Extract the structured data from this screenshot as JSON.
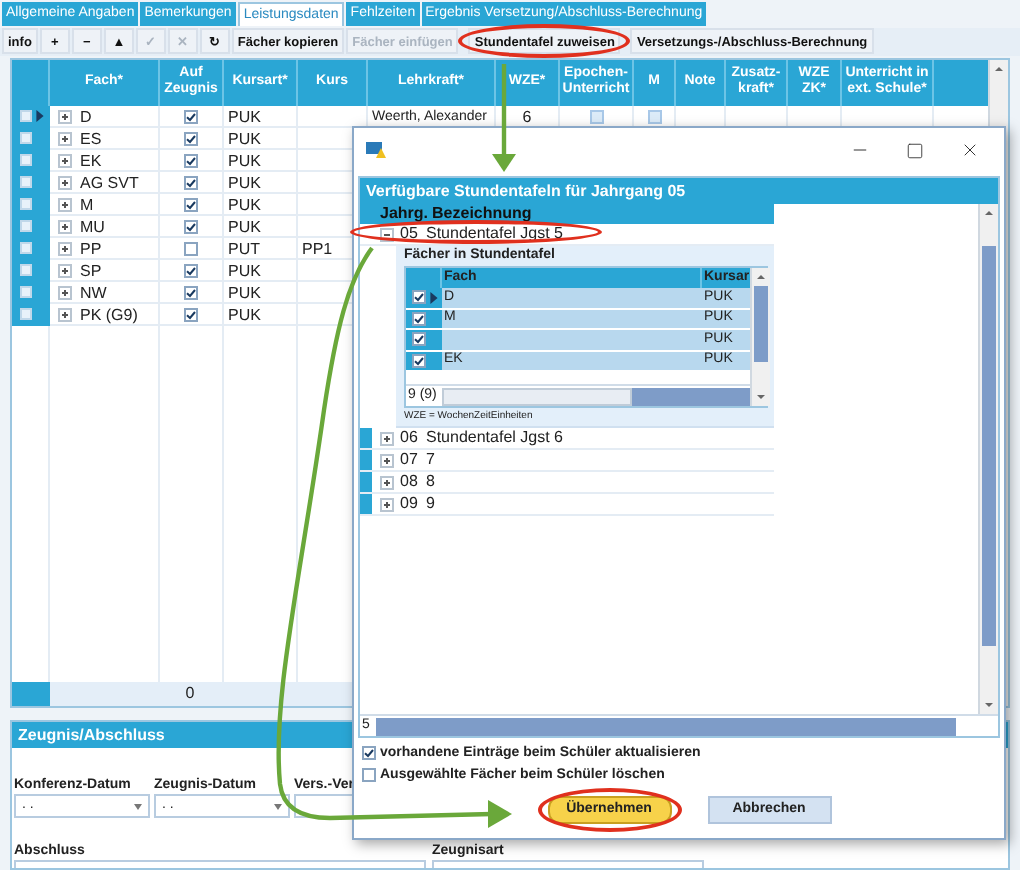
{
  "tabs": [
    {
      "label": "Allgemeine Angaben",
      "selected": false
    },
    {
      "label": "Bemerkungen",
      "selected": false
    },
    {
      "label": "Leistungsdaten",
      "selected": true
    },
    {
      "label": "Fehlzeiten",
      "selected": false
    },
    {
      "label": "Ergebnis Versetzung/Abschluss-Berechnung",
      "selected": false
    }
  ],
  "toolbar": [
    {
      "label": "info",
      "kind": "text",
      "disabled": false,
      "highlighted": false
    },
    {
      "label": "+",
      "kind": "symbol",
      "disabled": false,
      "highlighted": false
    },
    {
      "label": "−",
      "kind": "symbol",
      "disabled": false,
      "highlighted": false
    },
    {
      "label": "▲",
      "kind": "symbol",
      "disabled": false,
      "highlighted": false
    },
    {
      "label": "✓",
      "kind": "symbol",
      "disabled": true,
      "highlighted": false
    },
    {
      "label": "✕",
      "kind": "symbol",
      "disabled": true,
      "highlighted": false
    },
    {
      "label": "↻",
      "kind": "symbol",
      "disabled": false,
      "highlighted": false
    },
    {
      "label": "Fächer kopieren",
      "kind": "text",
      "disabled": false,
      "highlighted": false
    },
    {
      "label": "Fächer einfügen",
      "kind": "text",
      "disabled": true,
      "highlighted": false
    },
    {
      "label": "Stundentafel zuweisen",
      "kind": "text",
      "disabled": false,
      "highlighted": true
    },
    {
      "label": "Versetzungs-/Abschluss-Berechnung",
      "kind": "text",
      "disabled": false,
      "highlighted": false
    }
  ],
  "table": {
    "columns": [
      "Fach*",
      "Auf Zeugnis",
      "Kursart*",
      "Kurs",
      "Lehrkraft*",
      "WZE*",
      "Epochen-Unterricht",
      "M",
      "Note",
      "Zusatz-kraft*",
      "WZE ZK*",
      "Unterricht in ext. Schule*"
    ],
    "rows": [
      {
        "fach": "D",
        "auf_zeugnis": true,
        "kursart": "PUK",
        "kurs": "",
        "current": true,
        "lehrkraft": "Weerth, Alexander",
        "wze": "6",
        "epochen_unterricht": false,
        "m": false
      },
      {
        "fach": "ES",
        "auf_zeugnis": true,
        "kursart": "PUK",
        "kurs": "",
        "current": false
      },
      {
        "fach": "EK",
        "auf_zeugnis": true,
        "kursart": "PUK",
        "kurs": "",
        "current": false
      },
      {
        "fach": "AG SVT",
        "auf_zeugnis": true,
        "kursart": "PUK",
        "kurs": "",
        "current": false
      },
      {
        "fach": "M",
        "auf_zeugnis": true,
        "kursart": "PUK",
        "kurs": "",
        "current": false
      },
      {
        "fach": "MU",
        "auf_zeugnis": true,
        "kursart": "PUK",
        "kurs": "",
        "current": false
      },
      {
        "fach": "PP",
        "auf_zeugnis": false,
        "kursart": "PUT",
        "kurs": "PP1",
        "current": false
      },
      {
        "fach": "SP",
        "auf_zeugnis": true,
        "kursart": "PUK",
        "kurs": "",
        "current": false
      },
      {
        "fach": "NW",
        "auf_zeugnis": true,
        "kursart": "PUK",
        "kurs": "",
        "current": false
      },
      {
        "fach": "PK (G9)",
        "auf_zeugnis": true,
        "kursart": "PUK",
        "kurs": "",
        "current": false
      }
    ],
    "footer_count": "0"
  },
  "panel": {
    "title": "Zeugnis/Abschluss",
    "date_fields": [
      {
        "label": "Konferenz-Datum",
        "value": ". ."
      },
      {
        "label": "Zeugnis-Datum",
        "value": ". ."
      },
      {
        "label": "Vers.-Ver"
      }
    ],
    "select_fields": [
      {
        "label": "Abschluss"
      },
      {
        "label": "Zeugnisart"
      }
    ]
  },
  "dialog": {
    "header": "Verfügbare Stundentafeln für Jahrgang 05",
    "columns": [
      "Jahrg.",
      "Bezeichnung"
    ],
    "rows": [
      {
        "jahrg": "05",
        "bezeichnung": "Stundentafel Jgst 5",
        "expanded": true,
        "highlighted": true,
        "detail": {
          "title": "Fächer in Stundentafel",
          "columns": [
            "Fach",
            "Kursar"
          ],
          "rows": [
            {
              "fach": "D",
              "kursart": "PUK",
              "checked": true,
              "current": true
            },
            {
              "fach": "M",
              "kursart": "PUK",
              "checked": true,
              "current": false
            },
            {
              "fach": "",
              "kursart": "PUK",
              "checked": true,
              "current": false
            },
            {
              "fach": "EK",
              "kursart": "PUK",
              "checked": true,
              "current": false
            }
          ],
          "count": "9 (9)",
          "legend": "WZE = WochenZeitEinheiten"
        }
      },
      {
        "jahrg": "06",
        "bezeichnung": "Stundentafel Jgst 6",
        "expanded": false,
        "highlighted": false
      },
      {
        "jahrg": "07",
        "bezeichnung": "7",
        "expanded": false,
        "highlighted": false
      },
      {
        "jahrg": "08",
        "bezeichnung": "8",
        "expanded": false,
        "highlighted": false
      },
      {
        "jahrg": "09",
        "bezeichnung": "9",
        "expanded": false,
        "highlighted": false
      }
    ],
    "footer_count": "5",
    "options": [
      {
        "label": "vorhandene Einträge beim Schüler aktualisieren",
        "checked": true
      },
      {
        "label": "Ausgewählte Fächer beim Schüler löschen",
        "checked": false
      }
    ],
    "buttons": [
      {
        "label": "Übernehmen",
        "kind": "primary",
        "highlighted": true
      },
      {
        "label": "Abbrechen",
        "kind": "secondary",
        "highlighted": false
      }
    ]
  }
}
